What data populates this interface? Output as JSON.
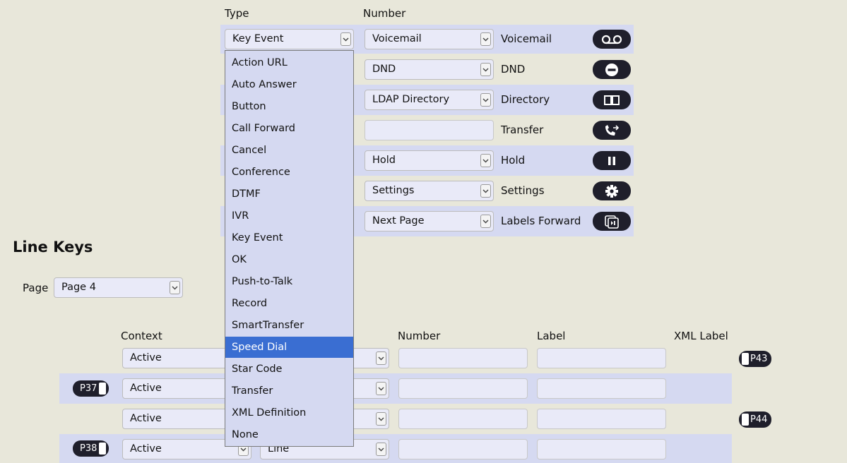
{
  "top": {
    "type_header": "Type",
    "number_header": "Number",
    "rows": [
      {
        "type": "Key Event",
        "number": "Voicemail",
        "label": "Voicemail",
        "icon": "voicemail-icon"
      },
      {
        "type": "",
        "number": "DND",
        "label": "DND",
        "icon": "dnd-icon"
      },
      {
        "type": "",
        "number": "LDAP Directory",
        "label": "Directory",
        "icon": "directory-book-icon"
      },
      {
        "type": "",
        "number": "",
        "label": "Transfer",
        "icon": "transfer-phone-icon"
      },
      {
        "type": "",
        "number": "Hold",
        "label": "Hold",
        "icon": "pause-icon"
      },
      {
        "type": "",
        "number": "Settings",
        "label": "Settings",
        "icon": "gear-icon"
      },
      {
        "type": "",
        "number": "Next Page",
        "label": "Labels Forward",
        "icon": "labels-forward-icon"
      }
    ]
  },
  "dropdown": {
    "items": [
      "Action URL",
      "Auto Answer",
      "Button",
      "Call Forward",
      "Cancel",
      "Conference",
      "DTMF",
      "IVR",
      "Key Event",
      "OK",
      "Push-to-Talk",
      "Record",
      "SmartTransfer",
      "Speed Dial",
      "Star Code",
      "Transfer",
      "XML Definition",
      "None"
    ],
    "highlighted": "Speed Dial"
  },
  "line_keys": {
    "title": "Line Keys",
    "page_label": "Page",
    "page_value": "Page 4",
    "headers": {
      "context": "Context",
      "number": "Number",
      "label": "Label",
      "xml_label": "XML Label"
    },
    "rows": [
      {
        "context": "Active",
        "type": "",
        "badge_left": "",
        "badge_right": "P43"
      },
      {
        "context": "Active",
        "type": "",
        "badge_left": "P37",
        "badge_right": ""
      },
      {
        "context": "Active",
        "type": "",
        "badge_left": "",
        "badge_right": "P44"
      },
      {
        "context": "Active",
        "type": "Line",
        "badge_left": "P38",
        "badge_right": ""
      }
    ]
  },
  "colors": {
    "background": "#e8e7da",
    "band": "#d5d9f1",
    "highlight": "#3a6ed2",
    "icon_pill": "#1f1f2b"
  }
}
